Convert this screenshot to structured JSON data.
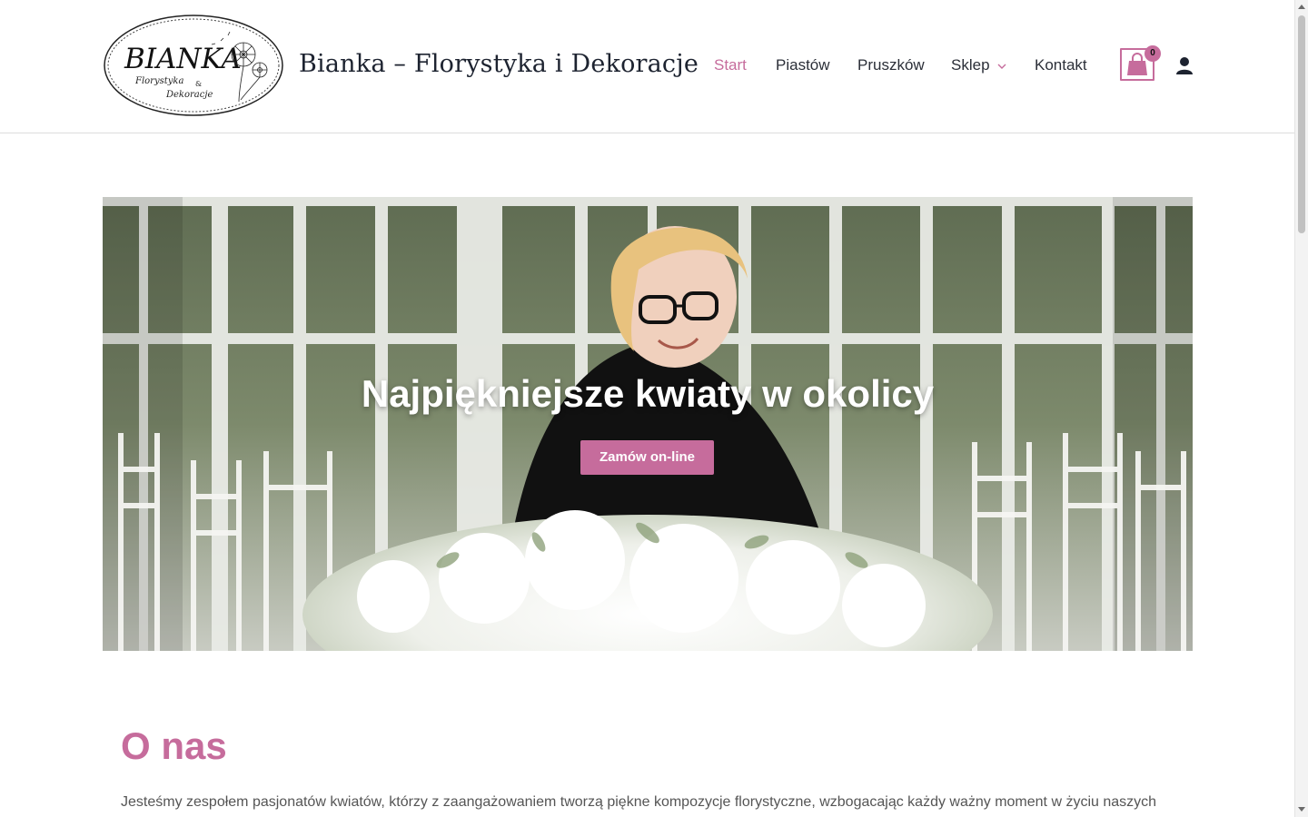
{
  "header": {
    "logo": {
      "main_text": "BIANKA",
      "sub_text_1": "Florystyka",
      "sub_text_amp": "&",
      "sub_text_2": "Dekoracje"
    },
    "site_title": "Bianka – Florystyka i Dekoracje",
    "nav": [
      {
        "label": "Start",
        "active": true
      },
      {
        "label": "Piastów",
        "active": false
      },
      {
        "label": "Pruszków",
        "active": false
      },
      {
        "label": "Sklep",
        "active": false,
        "has_dropdown": true
      },
      {
        "label": "Kontakt",
        "active": false
      }
    ],
    "cart": {
      "count": "0",
      "icon": "shopping-bag-icon"
    },
    "account_icon": "user-icon"
  },
  "hero": {
    "title": "Najpiękniejsze kwiaty w okolicy",
    "button_label": "Zamów on-line"
  },
  "about": {
    "title": "O nas",
    "text": "Jesteśmy zespołem pasjonatów kwiatów, którzy z zaangażowaniem tworzą piękne kompozycje florystyczne, wzbogacając każdy ważny moment w życiu naszych"
  },
  "colors": {
    "accent": "#c66c9c",
    "title_text": "#1d2330",
    "body_text": "#555555"
  }
}
